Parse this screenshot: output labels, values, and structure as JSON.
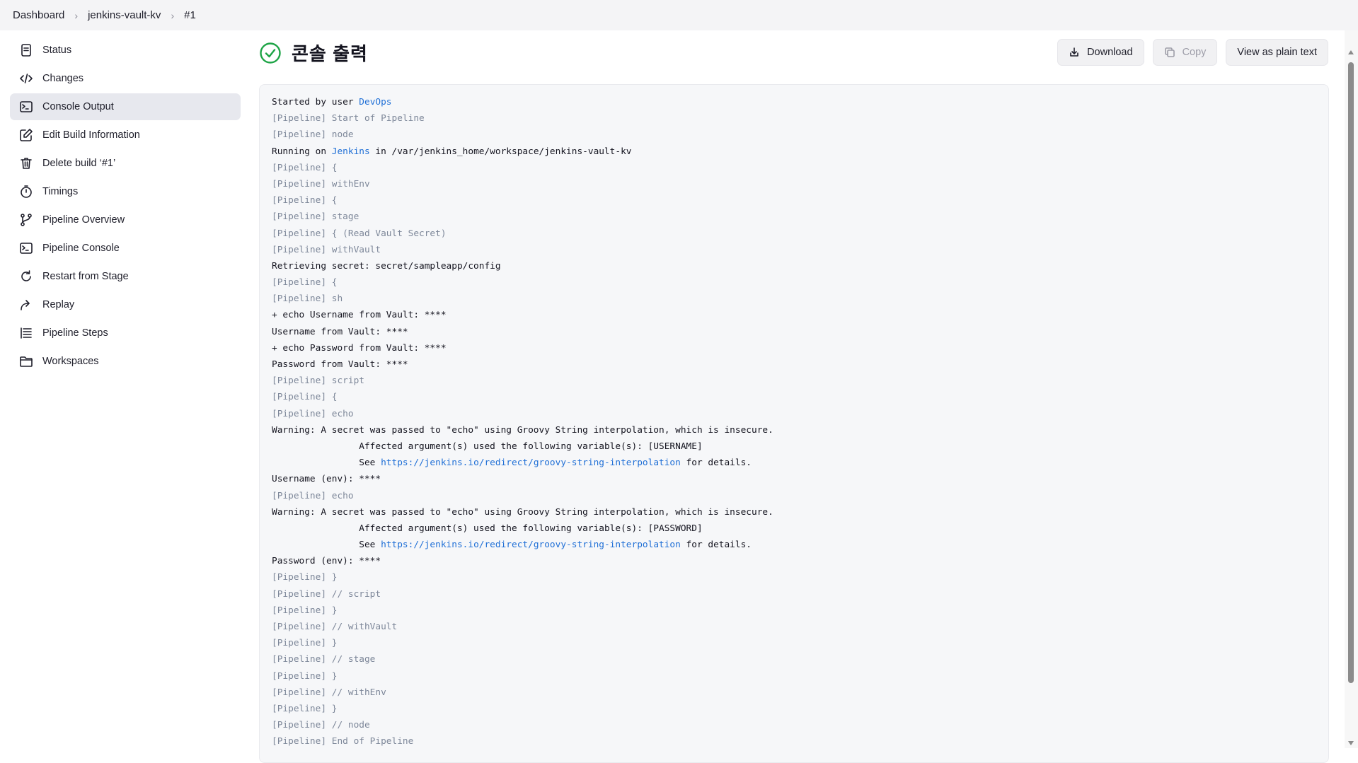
{
  "breadcrumb": {
    "items": [
      "Dashboard",
      "jenkins-vault-kv",
      "#1"
    ]
  },
  "sidebar": {
    "items": [
      {
        "label": "Status",
        "icon": "document-icon"
      },
      {
        "label": "Changes",
        "icon": "code-icon"
      },
      {
        "label": "Console Output",
        "icon": "terminal-icon",
        "active": true
      },
      {
        "label": "Edit Build Information",
        "icon": "edit-icon"
      },
      {
        "label": "Delete build ‘#1’",
        "icon": "trash-icon"
      },
      {
        "label": "Timings",
        "icon": "stopwatch-icon"
      },
      {
        "label": "Pipeline Overview",
        "icon": "branch-icon"
      },
      {
        "label": "Pipeline Console",
        "icon": "terminal-icon"
      },
      {
        "label": "Restart from Stage",
        "icon": "refresh-icon"
      },
      {
        "label": "Replay",
        "icon": "replay-icon"
      },
      {
        "label": "Pipeline Steps",
        "icon": "list-icon"
      },
      {
        "label": "Workspaces",
        "icon": "folder-icon"
      }
    ]
  },
  "header": {
    "title": "콘솔 출력",
    "status": "success",
    "status_color": "#1ea446"
  },
  "actions": {
    "download_label": "Download",
    "copy_label": "Copy",
    "plain_text_label": "View as plain text"
  },
  "console": {
    "lines": [
      "Started by user DevOps",
      "[Pipeline] Start of Pipeline",
      "[Pipeline] node",
      "Running on Jenkins in /var/jenkins_home/workspace/jenkins-vault-kv",
      "[Pipeline] {",
      "[Pipeline] withEnv",
      "[Pipeline] {",
      "[Pipeline] stage",
      "[Pipeline] { (Read Vault Secret)",
      "[Pipeline] withVault",
      "Retrieving secret: secret/sampleapp/config",
      "[Pipeline] {",
      "[Pipeline] sh",
      "+ echo Username from Vault: ****",
      "Username from Vault: ****",
      "+ echo Password from Vault: ****",
      "Password from Vault: ****",
      "[Pipeline] script",
      "[Pipeline] {",
      "[Pipeline] echo",
      "Warning: A secret was passed to \"echo\" using Groovy String interpolation, which is insecure.",
      "\t\t Affected argument(s) used the following variable(s): [USERNAME]",
      "\t\t See https://jenkins.io/redirect/groovy-string-interpolation for details.",
      "Username (env): ****",
      "[Pipeline] echo",
      "Warning: A secret was passed to \"echo\" using Groovy String interpolation, which is insecure.",
      "\t\t Affected argument(s) used the following variable(s): [PASSWORD]",
      "\t\t See https://jenkins.io/redirect/groovy-string-interpolation for details.",
      "Password (env): ****",
      "[Pipeline] }",
      "[Pipeline] // script",
      "[Pipeline] }",
      "[Pipeline] // withVault",
      "[Pipeline] }",
      "[Pipeline] // stage",
      "[Pipeline] }",
      "[Pipeline] // withEnv",
      "[Pipeline] }",
      "[Pipeline] // node",
      "[Pipeline] End of Pipeline"
    ],
    "links": [
      "DevOps",
      "Jenkins",
      "https://jenkins.io/redirect/groovy-string-interpolation"
    ],
    "link_color": "#1f6fd6",
    "pipeline_color": "#7d8799"
  }
}
